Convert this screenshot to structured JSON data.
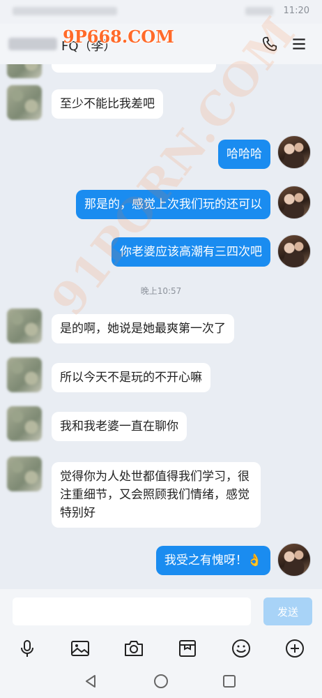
{
  "status_bar": {
    "time": "11:20"
  },
  "header": {
    "contact_name": "FQ（李）",
    "watermark": "9P668.COM"
  },
  "watermark_diagonal": "91PORN.COM",
  "messages": [
    {
      "side": "left",
      "text": "至少不能比我差吧"
    },
    {
      "side": "right",
      "text": "哈哈哈"
    },
    {
      "side": "right",
      "text": "那是的，感觉上次我们玩的还可以"
    },
    {
      "side": "right",
      "text": "你老婆应该高潮有三四次吧"
    },
    {
      "side": "left",
      "text": "是的啊，她说是她最爽第一次了"
    },
    {
      "side": "left",
      "text": "所以今天不是玩的不开心嘛"
    },
    {
      "side": "left",
      "text": "我和我老婆一直在聊你"
    },
    {
      "side": "left",
      "text": "觉得你为人处世都值得我们学习，很注重细节，又会照顾我们情绪，感觉特别好"
    },
    {
      "side": "right",
      "text": "我受之有愧呀！👌"
    }
  ],
  "timestamp": "晚上10:57",
  "input": {
    "value": "",
    "placeholder": ""
  },
  "send_label": "发送",
  "toolbar_icons": [
    "microphone-icon",
    "image-icon",
    "camera-icon",
    "package-icon",
    "emoji-icon",
    "plus-icon"
  ],
  "nav_icons": [
    "back-triangle-icon",
    "home-circle-icon",
    "recents-square-icon"
  ],
  "colors": {
    "sent_bubble": "#1a8cf0",
    "received_bubble": "#ffffff",
    "background": "#e9edf3",
    "send_button": "#a8d3f7",
    "watermark": "#ff6a2a"
  }
}
